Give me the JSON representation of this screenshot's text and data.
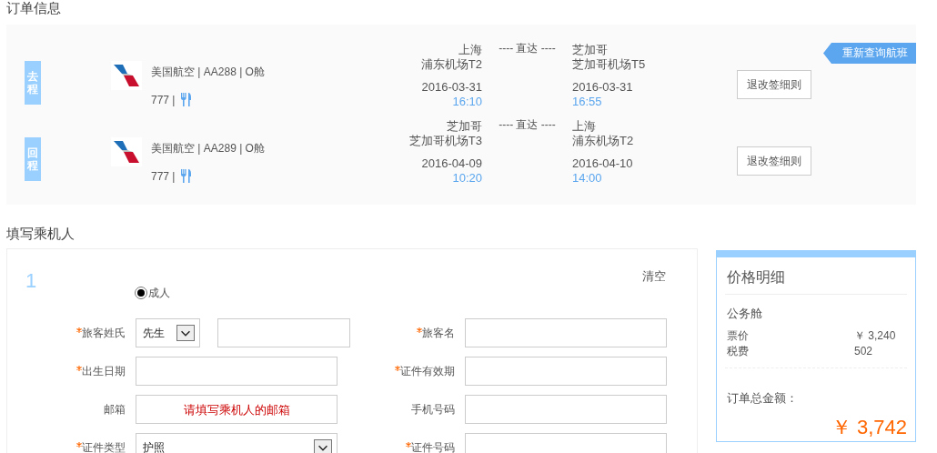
{
  "order_section": {
    "title": "订单信息",
    "requery_button": "重新查询航班"
  },
  "flights": [
    {
      "direction": "去程",
      "airline": "美国航空 | AA288 | O舱",
      "aircraft": "777 |",
      "departure": {
        "city": "上海",
        "airport": "浦东机场T2",
        "date": "2016-03-31",
        "time": "16:10"
      },
      "route": "---- 直达 ----",
      "arrival": {
        "city": "芝加哥",
        "airport": "芝加哥机场T5",
        "date": "2016-03-31",
        "time": "16:55"
      },
      "rules_button": "退改签细则"
    },
    {
      "direction": "回程",
      "airline": "美国航空 | AA289 | O舱",
      "aircraft": "777 |",
      "departure": {
        "city": "芝加哥",
        "airport": "芝加哥机场T3",
        "date": "2016-04-09",
        "time": "10:20"
      },
      "route": "---- 直达 ----",
      "arrival": {
        "city": "上海",
        "airport": "浦东机场T2",
        "date": "2016-04-10",
        "time": "14:00"
      },
      "rules_button": "退改签细则"
    }
  ],
  "passenger_section": {
    "title": "填写乘机人"
  },
  "passenger": {
    "number": "1",
    "clear_link": "清空",
    "types": [
      {
        "label": "成人",
        "selected": true
      }
    ],
    "fields": [
      {
        "label": "旅客姓氏",
        "required": true,
        "kind": "title-name",
        "value": "先生"
      },
      {
        "label": "旅客名",
        "required": true,
        "kind": "text"
      },
      {
        "label": "出生日期",
        "required": true,
        "kind": "text"
      },
      {
        "label": "证件有效期",
        "required": true,
        "kind": "text"
      },
      {
        "label": "邮箱",
        "required": false,
        "kind": "text",
        "placeholder": "请填写乘机人的邮箱"
      },
      {
        "label": "手机号码",
        "required": false,
        "kind": "text"
      },
      {
        "label": "证件类型",
        "required": true,
        "kind": "select",
        "value": "护照"
      },
      {
        "label": "证件号码",
        "required": true,
        "kind": "text"
      }
    ]
  },
  "price": {
    "title": "价格明细",
    "cabin": "公务舱",
    "items": [
      {
        "label": "票价",
        "value": "￥ 3,240"
      },
      {
        "label": "税费",
        "value": "502"
      }
    ],
    "total_label": "订单总金额：",
    "total": "￥ 3,742"
  }
}
